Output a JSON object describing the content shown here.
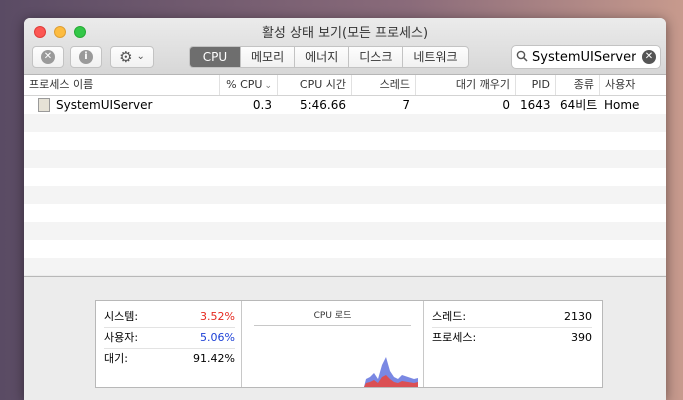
{
  "window": {
    "title": "활성 상태 보기(모든 프로세스)"
  },
  "toolbar": {
    "close_process_glyph": "✕",
    "info_glyph": "i",
    "gear_glyph": "⚙",
    "chevron_glyph": "⌄"
  },
  "tabs": [
    {
      "label": "CPU",
      "active": true
    },
    {
      "label": "메모리"
    },
    {
      "label": "에너지"
    },
    {
      "label": "디스크"
    },
    {
      "label": "네트워크"
    }
  ],
  "search": {
    "value": "SystemUIServer",
    "clear_glyph": "✕"
  },
  "table": {
    "headers": [
      "프로세스 이름",
      "% CPU",
      "CPU 시간",
      "스레드",
      "대기 깨우기",
      "PID",
      "종류",
      "사용자"
    ],
    "sort_glyph": "⌄",
    "rows": [
      {
        "name": "SystemUIServer",
        "cpu": "0.3",
        "cpu_time": "5:46.66",
        "threads": "7",
        "wakeups": "0",
        "pid": "1643",
        "kind": "64비트",
        "user": "Home"
      }
    ]
  },
  "summary": {
    "system_label": "시스템:",
    "system_value": "3.52%",
    "user_label": "사용자:",
    "user_value": "5.06%",
    "idle_label": "대기:",
    "idle_value": "91.42%",
    "graph_title": "CPU 로드",
    "threads_label": "스레드:",
    "threads_value": "2130",
    "processes_label": "프로세스:",
    "processes_value": "390"
  },
  "colors": {
    "system": "#e5281f",
    "user": "#1b3fd6"
  }
}
